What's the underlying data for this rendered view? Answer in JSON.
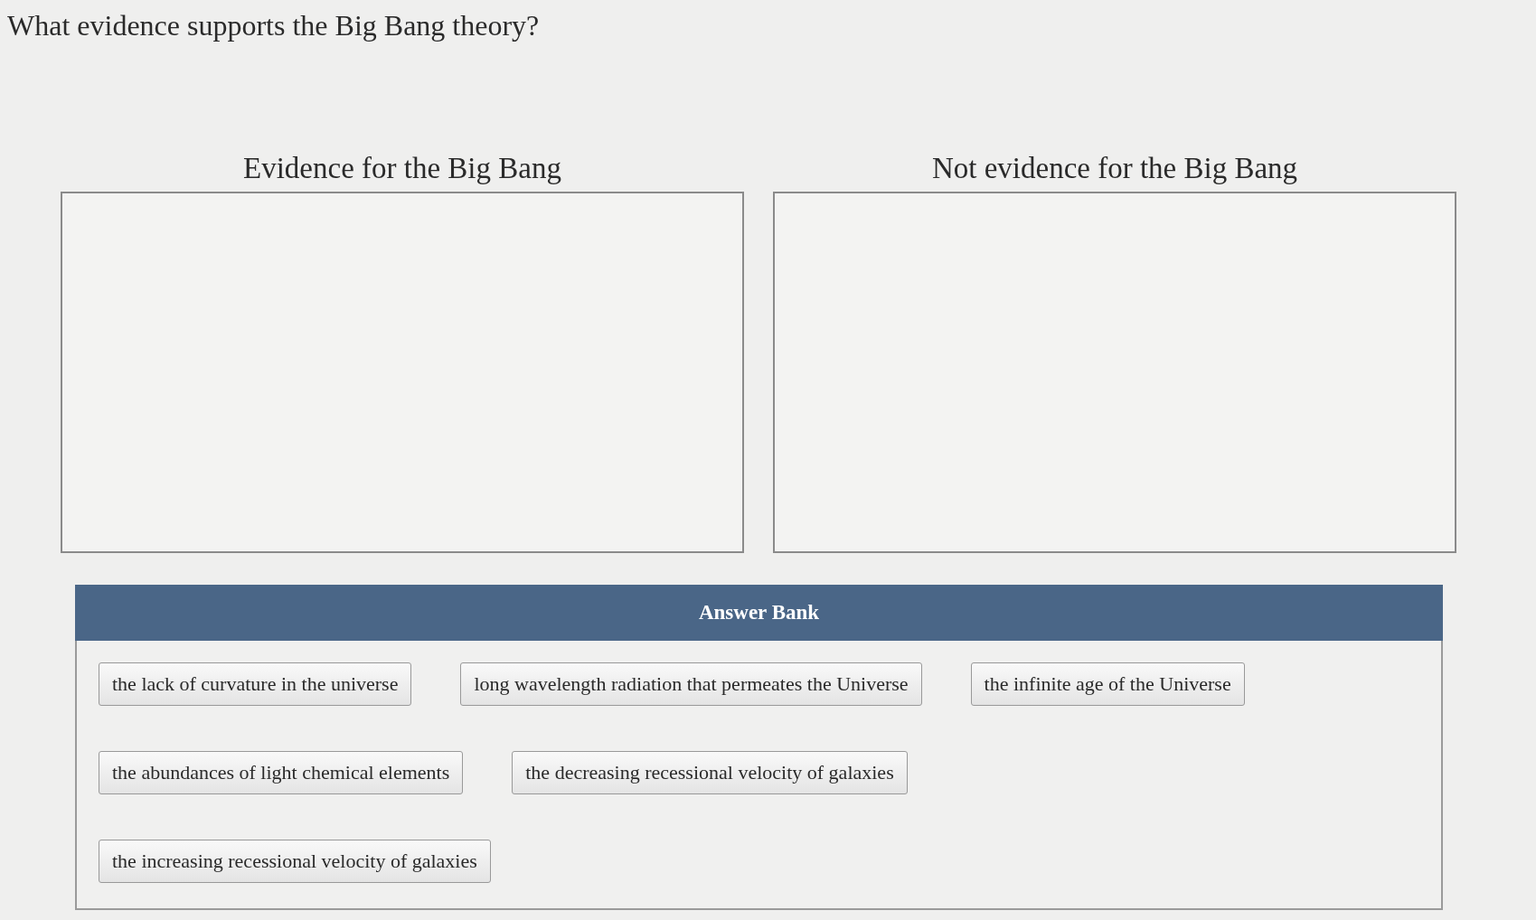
{
  "question": "What evidence supports the Big Bang theory?",
  "categories": [
    {
      "heading": "Evidence for the Big Bang"
    },
    {
      "heading": "Not evidence for the Big Bang"
    }
  ],
  "answer_bank": {
    "title": "Answer Bank",
    "rows": [
      {
        "items": [
          "the lack of curvature in the universe",
          "long wavelength radiation that permeates the Universe",
          "the infinite age of the Universe"
        ]
      },
      {
        "items": [
          "the abundances of light chemical elements",
          "the decreasing recessional velocity of galaxies"
        ]
      },
      {
        "items": [
          "the increasing recessional velocity of galaxies"
        ]
      }
    ]
  }
}
